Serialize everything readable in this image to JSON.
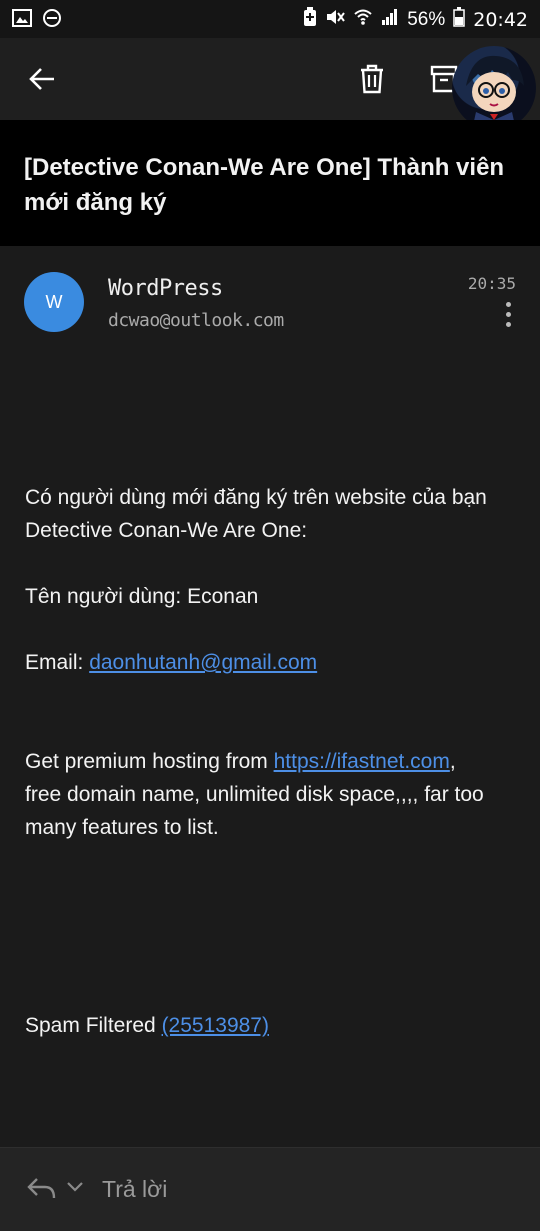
{
  "status": {
    "battery_percent": "56%",
    "time": "20:42"
  },
  "toolbar": {
    "back": "back",
    "delete": "delete",
    "archive": "archive"
  },
  "subject": "[Detective Conan-We Are One] Thành viên mới đăng ký",
  "message": {
    "avatar_letter": "W",
    "sender_name": "WordPress",
    "sender_email": "dcwao@outlook.com",
    "time": "20:35",
    "intro_line1": "Có người dùng mới đăng ký trên website của bạn",
    "intro_line2": "Detective Conan-We Are One:",
    "username_line": "Tên người dùng: Econan",
    "email_label": "Email: ",
    "email_link": "daonhutanh@gmail.com",
    "promo_prefix": "Get premium hosting from ",
    "promo_link": "https://ifastnet.com",
    "promo_comma": ",",
    "promo_line2": "free domain name, unlimited disk space,,,, far too",
    "promo_line3": "many features to list.",
    "spam_label": "Spam Filtered ",
    "spam_link": "(25513987)"
  },
  "reply": {
    "label": "Trả lời"
  }
}
